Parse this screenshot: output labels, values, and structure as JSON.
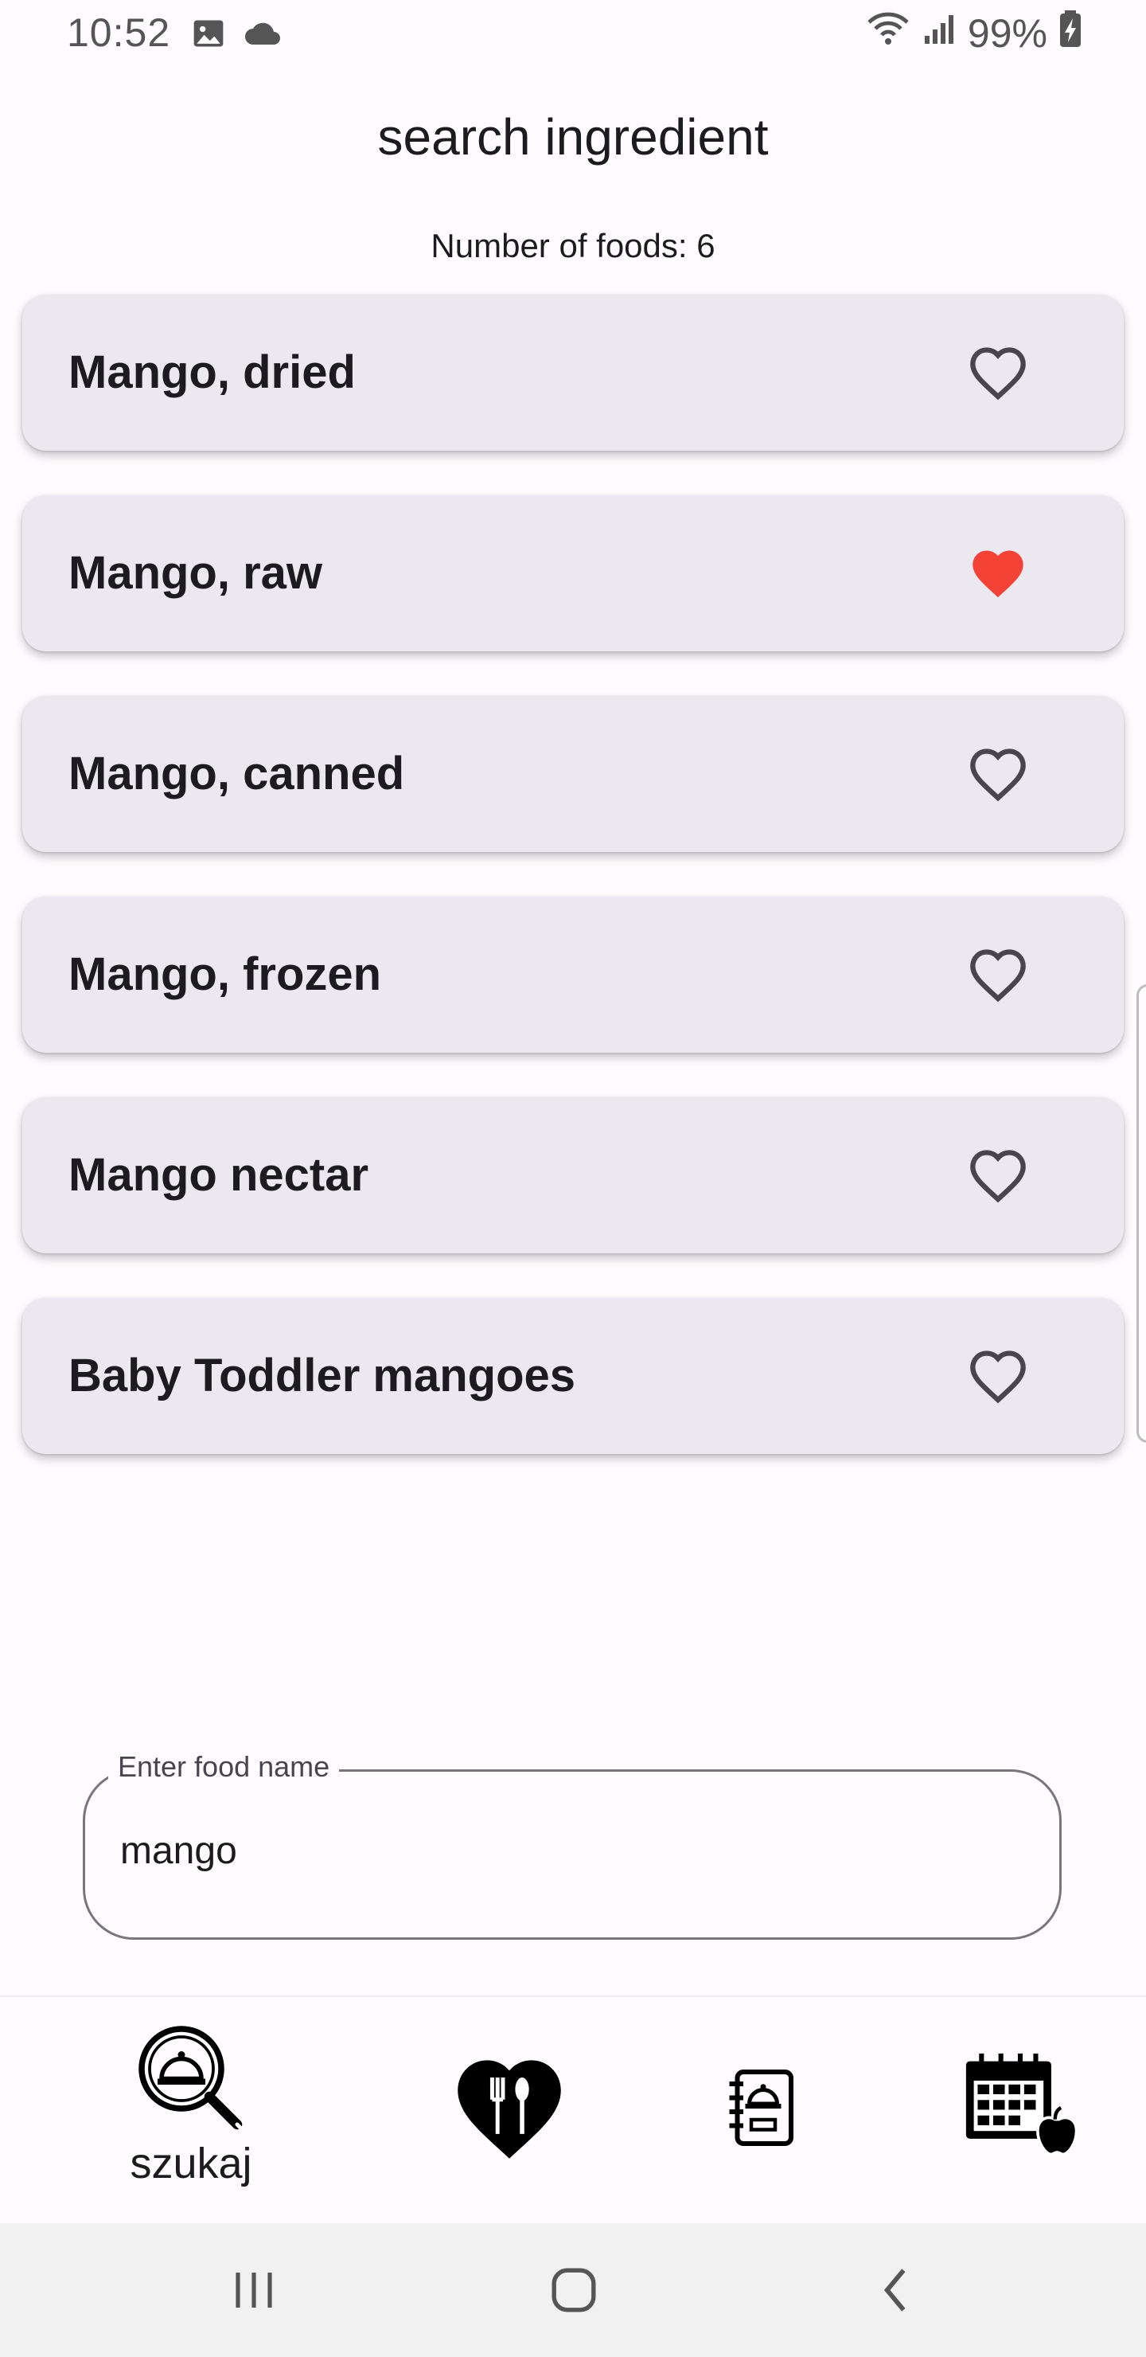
{
  "status_bar": {
    "time": "10:52",
    "battery": "99%",
    "icons": [
      "image-icon",
      "cloud-icon",
      "wifi-icon",
      "signal-icon",
      "battery-charging-icon"
    ]
  },
  "header": {
    "title": "search ingredient",
    "count_text": "Number of foods: 6"
  },
  "foods": [
    {
      "name": "Mango, dried",
      "favorite": false
    },
    {
      "name": "Mango, raw",
      "favorite": true
    },
    {
      "name": "Mango, canned",
      "favorite": false
    },
    {
      "name": "Mango, frozen",
      "favorite": false
    },
    {
      "name": "Mango nectar",
      "favorite": false
    },
    {
      "name": "Baby Toddler mangoes",
      "favorite": false
    }
  ],
  "search": {
    "label": "Enter food name",
    "value": "mango"
  },
  "bottom_nav": {
    "items": [
      {
        "label": "szukaj",
        "icon": "search-dish-icon",
        "active": true
      },
      {
        "label": "",
        "icon": "heart-cutlery-icon",
        "active": false
      },
      {
        "label": "",
        "icon": "recipe-book-icon",
        "active": false
      },
      {
        "label": "",
        "icon": "calendar-apple-icon",
        "active": false
      }
    ]
  },
  "system_nav": {
    "icons": [
      "recent-apps-icon",
      "home-icon",
      "back-icon"
    ]
  },
  "colors": {
    "favorite_active": "#f44336",
    "card_background": "#ece8ef",
    "page_background": "#fffbfe"
  }
}
